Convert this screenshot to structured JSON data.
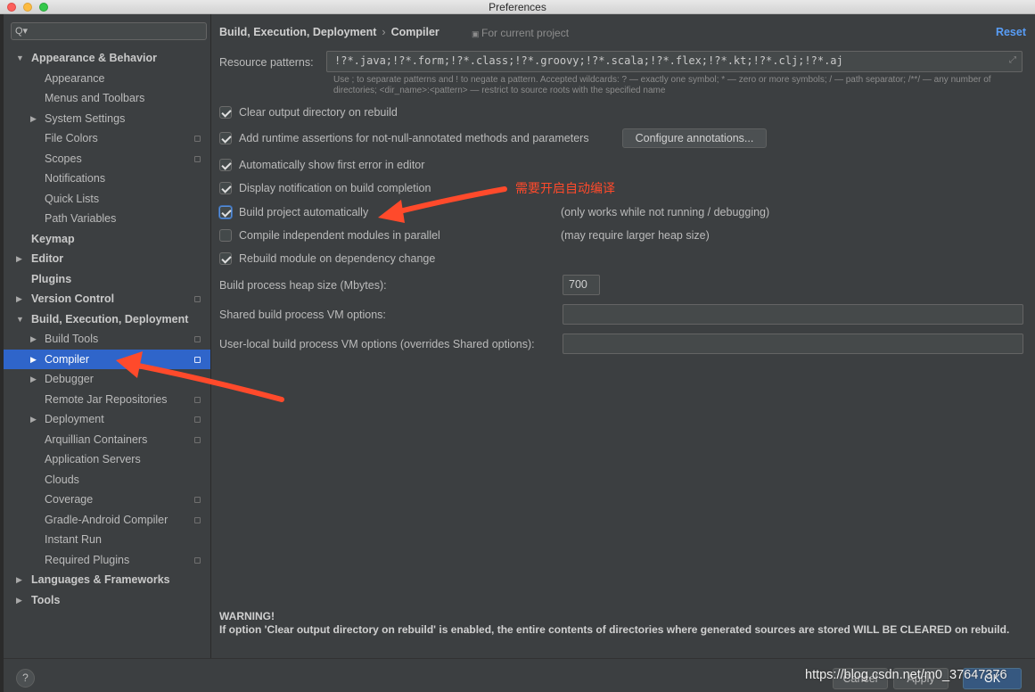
{
  "window": {
    "title": "Preferences"
  },
  "sidebar": {
    "search_icon": "Q▾",
    "items": [
      {
        "label": "Appearance & Behavior",
        "level": 0,
        "arrow": "▼",
        "bold": true,
        "copy": false
      },
      {
        "label": "Appearance",
        "level": 1,
        "arrow": "",
        "bold": false,
        "copy": false
      },
      {
        "label": "Menus and Toolbars",
        "level": 1,
        "arrow": "",
        "bold": false,
        "copy": false
      },
      {
        "label": "System Settings",
        "level": 1,
        "arrow": "▶",
        "bold": false,
        "copy": false
      },
      {
        "label": "File Colors",
        "level": 1,
        "arrow": "",
        "bold": false,
        "copy": true
      },
      {
        "label": "Scopes",
        "level": 1,
        "arrow": "",
        "bold": false,
        "copy": true
      },
      {
        "label": "Notifications",
        "level": 1,
        "arrow": "",
        "bold": false,
        "copy": false
      },
      {
        "label": "Quick Lists",
        "level": 1,
        "arrow": "",
        "bold": false,
        "copy": false
      },
      {
        "label": "Path Variables",
        "level": 1,
        "arrow": "",
        "bold": false,
        "copy": false
      },
      {
        "label": "Keymap",
        "level": 0,
        "arrow": "",
        "bold": true,
        "copy": false
      },
      {
        "label": "Editor",
        "level": 0,
        "arrow": "▶",
        "bold": true,
        "copy": false
      },
      {
        "label": "Plugins",
        "level": 0,
        "arrow": "",
        "bold": true,
        "copy": false
      },
      {
        "label": "Version Control",
        "level": 0,
        "arrow": "▶",
        "bold": true,
        "copy": true
      },
      {
        "label": "Build, Execution, Deployment",
        "level": 0,
        "arrow": "▼",
        "bold": true,
        "copy": false
      },
      {
        "label": "Build Tools",
        "level": 1,
        "arrow": "▶",
        "bold": false,
        "copy": true
      },
      {
        "label": "Compiler",
        "level": 1,
        "arrow": "▶",
        "bold": false,
        "copy": true,
        "selected": true
      },
      {
        "label": "Debugger",
        "level": 1,
        "arrow": "▶",
        "bold": false,
        "copy": false
      },
      {
        "label": "Remote Jar Repositories",
        "level": 1,
        "arrow": "",
        "bold": false,
        "copy": true
      },
      {
        "label": "Deployment",
        "level": 1,
        "arrow": "▶",
        "bold": false,
        "copy": true
      },
      {
        "label": "Arquillian Containers",
        "level": 1,
        "arrow": "",
        "bold": false,
        "copy": true
      },
      {
        "label": "Application Servers",
        "level": 1,
        "arrow": "",
        "bold": false,
        "copy": false
      },
      {
        "label": "Clouds",
        "level": 1,
        "arrow": "",
        "bold": false,
        "copy": false
      },
      {
        "label": "Coverage",
        "level": 1,
        "arrow": "",
        "bold": false,
        "copy": true
      },
      {
        "label": "Gradle-Android Compiler",
        "level": 1,
        "arrow": "",
        "bold": false,
        "copy": true
      },
      {
        "label": "Instant Run",
        "level": 1,
        "arrow": "",
        "bold": false,
        "copy": false
      },
      {
        "label": "Required Plugins",
        "level": 1,
        "arrow": "",
        "bold": false,
        "copy": true
      },
      {
        "label": "Languages & Frameworks",
        "level": 0,
        "arrow": "▶",
        "bold": true,
        "copy": false
      },
      {
        "label": "Tools",
        "level": 0,
        "arrow": "▶",
        "bold": true,
        "copy": false
      }
    ]
  },
  "main": {
    "breadcrumb": {
      "section": "Build, Execution, Deployment",
      "separator": "›",
      "page": "Compiler"
    },
    "scope_note": "For current project",
    "reset_label": "Reset",
    "resource_patterns": {
      "label": "Resource patterns:",
      "value": "!?*.java;!?*.form;!?*.class;!?*.groovy;!?*.scala;!?*.flex;!?*.kt;!?*.clj;!?*.aj",
      "help": "Use ; to separate patterns and ! to negate a pattern. Accepted wildcards: ? — exactly one symbol; * — zero or more symbols; / — path separator; /**/ — any number of directories; <dir_name>:<pattern> — restrict to source roots with the specified name"
    },
    "checkboxes": {
      "clear_output": {
        "label": "Clear output directory on rebuild",
        "checked": true
      },
      "runtime_assertions": {
        "label": "Add runtime assertions for not-null-annotated methods and parameters",
        "checked": true
      },
      "show_first_error": {
        "label": "Automatically show first error in editor",
        "checked": true
      },
      "display_notification": {
        "label": "Display notification on build completion",
        "checked": true
      },
      "build_automatically": {
        "label": "Build project automatically",
        "checked": true,
        "note": "(only works while not running / debugging)"
      },
      "compile_parallel": {
        "label": "Compile independent modules in parallel",
        "checked": false,
        "note": "(may require larger heap size)"
      },
      "rebuild_module": {
        "label": "Rebuild module on dependency change",
        "checked": true
      }
    },
    "configure_annotations_label": "Configure annotations...",
    "heap_size": {
      "label": "Build process heap size (Mbytes):",
      "value": "700"
    },
    "shared_vm": {
      "label": "Shared build process VM options:",
      "value": ""
    },
    "user_local_vm": {
      "label": "User-local build process VM options (overrides Shared options):",
      "value": ""
    },
    "warning": {
      "title": "WARNING!",
      "text": "If option 'Clear output directory on rebuild' is enabled, the entire contents of directories where generated sources are stored WILL BE CLEARED on rebuild."
    }
  },
  "bottom": {
    "help_label": "?",
    "cancel_label": "Cancel",
    "apply_label": "Apply",
    "ok_label": "OK",
    "watermark": "https://blog.csdn.net/m0_37647376"
  },
  "annotation": {
    "text": "需要开启自动编译",
    "color": "#ff4a2b"
  },
  "colors": {
    "selection": "#2f65ca",
    "link": "#589df6",
    "background": "#3c3f41"
  }
}
